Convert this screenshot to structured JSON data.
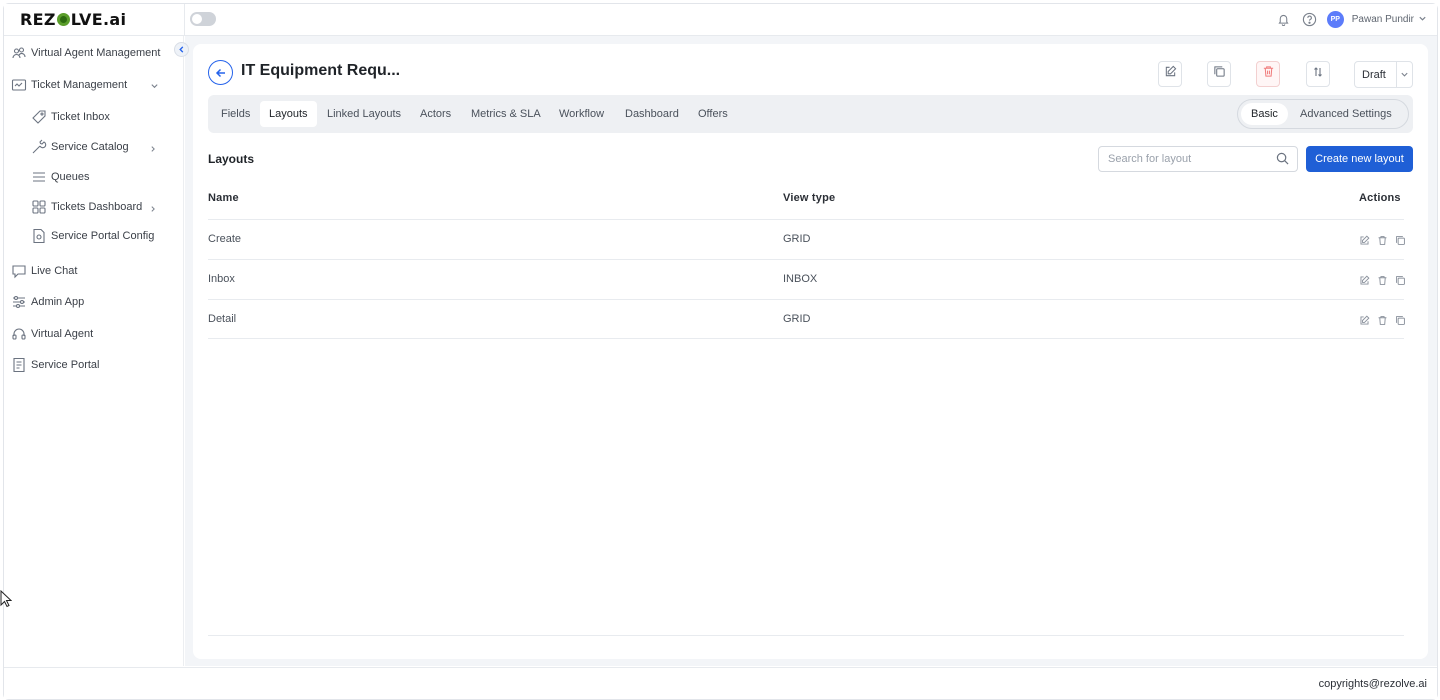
{
  "app": {
    "logo_text_1": "REZ",
    "logo_text_2": "LVE.ai",
    "user": {
      "initials": "PP",
      "name": "Pawan Pundir"
    }
  },
  "sidebar": {
    "items": [
      {
        "label": "Virtual Agent Management",
        "icon": "users-icon"
      },
      {
        "label": "Ticket Management",
        "icon": "ticket-board-icon"
      },
      {
        "label": "Ticket Inbox",
        "icon": "tag-icon"
      },
      {
        "label": "Service Catalog",
        "icon": "wrench-icon"
      },
      {
        "label": "Queues",
        "icon": "list-icon"
      },
      {
        "label": "Tickets Dashboard",
        "icon": "grid-icon"
      },
      {
        "label": "Service Portal Config",
        "icon": "settings-doc-icon"
      },
      {
        "label": "Live Chat",
        "icon": "chat-icon"
      },
      {
        "label": "Admin App",
        "icon": "sliders-icon"
      },
      {
        "label": "Virtual Agent",
        "icon": "headset-icon"
      },
      {
        "label": "Service Portal",
        "icon": "portal-icon"
      }
    ]
  },
  "header": {
    "title": "IT Equipment Requ...",
    "status": "Draft"
  },
  "tabs": [
    "Fields",
    "Layouts",
    "Linked Layouts",
    "Actors",
    "Metrics & SLA",
    "Workflow",
    "Dashboard",
    "Offers"
  ],
  "active_tab": "Layouts",
  "mode": {
    "options": [
      "Basic",
      "Advanced Settings"
    ],
    "selected": "Basic"
  },
  "layouts": {
    "section_title": "Layouts",
    "search_placeholder": "Search for layout",
    "create_label": "Create new layout",
    "columns": [
      "Name",
      "View type",
      "Actions"
    ],
    "rows": [
      {
        "name": "Create",
        "view_type": "GRID"
      },
      {
        "name": "Inbox",
        "view_type": "INBOX"
      },
      {
        "name": "Detail",
        "view_type": "GRID"
      }
    ]
  },
  "footer": {
    "copyright": "copyrights@rezolve.ai"
  },
  "colors": {
    "primary": "#1f5fd6",
    "danger": "#f07b7b",
    "background": "#f3f5f8"
  }
}
